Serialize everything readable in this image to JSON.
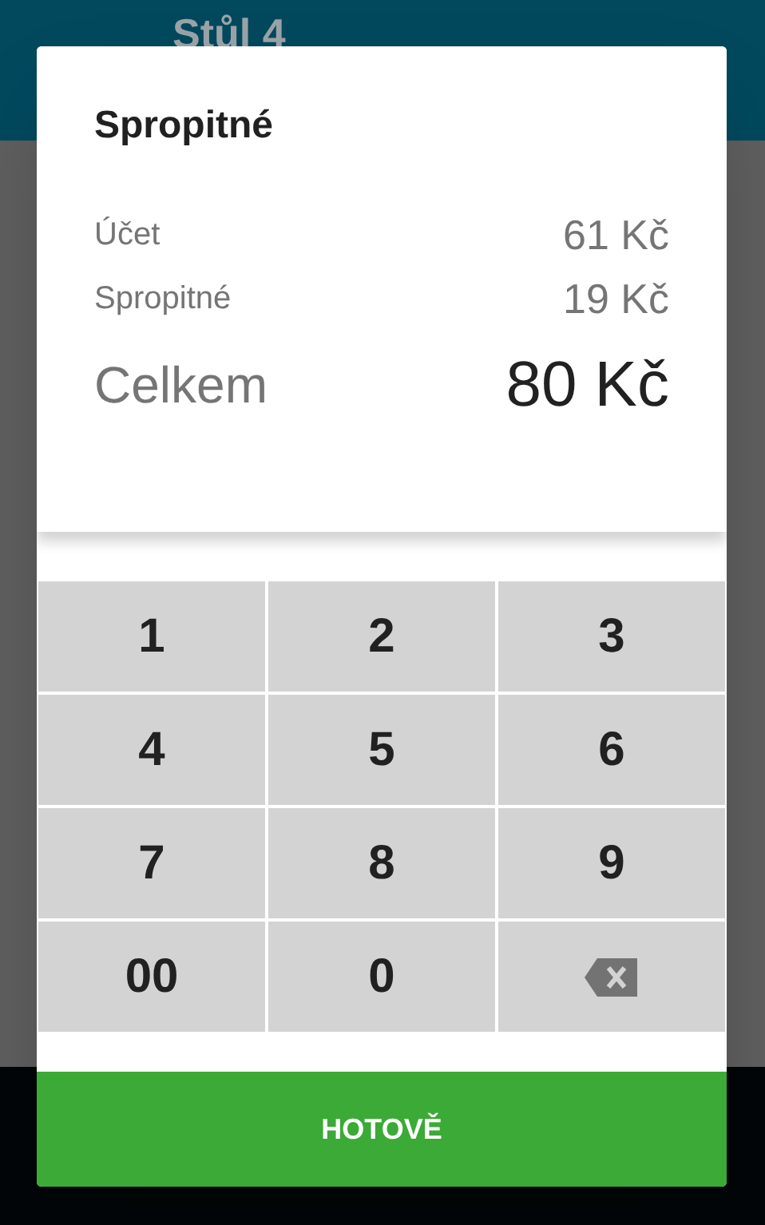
{
  "background": {
    "title": "Stůl 4"
  },
  "dialog": {
    "title": "Spropitné",
    "lines": [
      {
        "kind": "normal",
        "label": "Účet",
        "value": "61 Kč"
      },
      {
        "kind": "normal",
        "label": "Spropitné",
        "value": "19 Kč"
      },
      {
        "kind": "total",
        "label": "Celkem",
        "value": "80 Kč"
      }
    ],
    "keys": [
      {
        "kind": "digit",
        "label": "1"
      },
      {
        "kind": "digit",
        "label": "2"
      },
      {
        "kind": "digit",
        "label": "3"
      },
      {
        "kind": "digit",
        "label": "4"
      },
      {
        "kind": "digit",
        "label": "5"
      },
      {
        "kind": "digit",
        "label": "6"
      },
      {
        "kind": "digit",
        "label": "7"
      },
      {
        "kind": "digit",
        "label": "8"
      },
      {
        "kind": "digit",
        "label": "9"
      },
      {
        "kind": "digit",
        "label": "00"
      },
      {
        "kind": "digit",
        "label": "0"
      },
      {
        "kind": "backspace"
      }
    ],
    "button": "HOTOVĚ"
  }
}
